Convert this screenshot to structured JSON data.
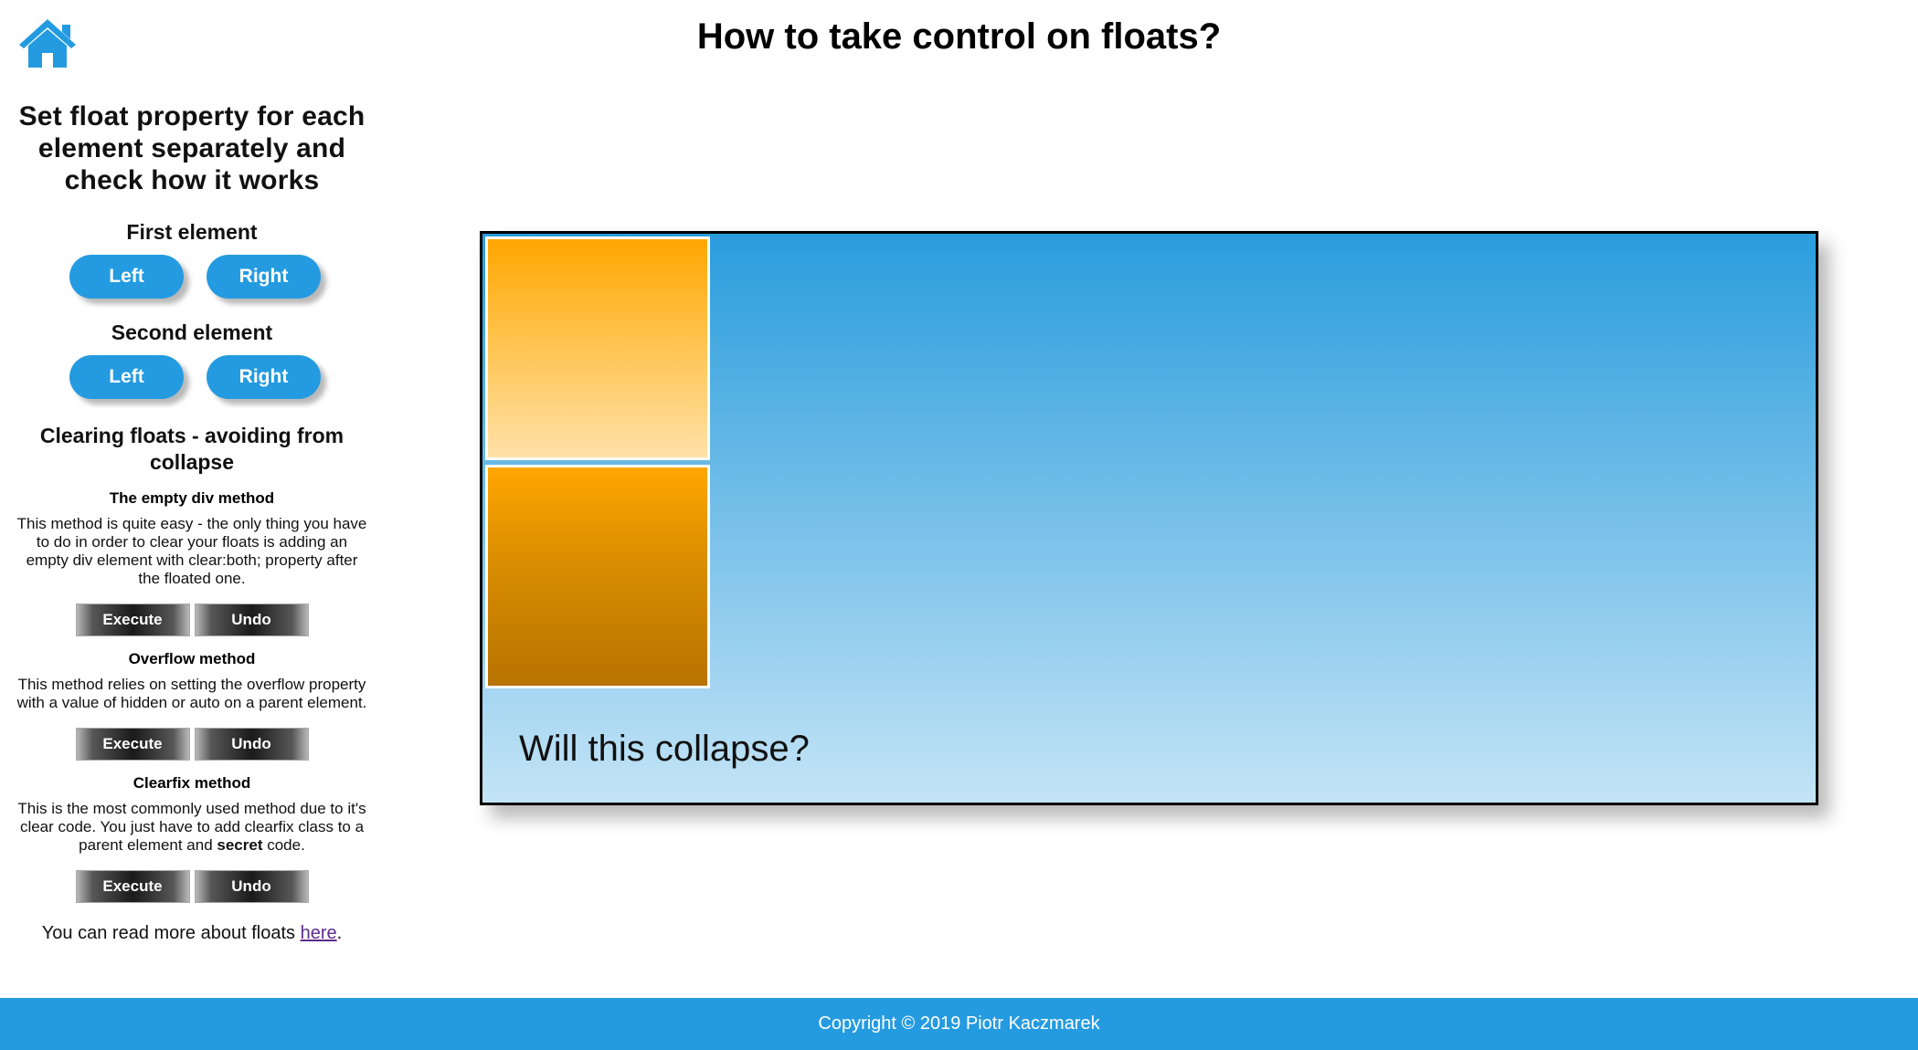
{
  "header": {
    "title": "How to take control on floats?",
    "home_icon": "house-icon"
  },
  "sidebar": {
    "heading": "Set float property for each element separately and check how it works",
    "float_controls": [
      {
        "title": "First element",
        "left_label": "Left",
        "right_label": "Right"
      },
      {
        "title": "Second element",
        "left_label": "Left",
        "right_label": "Right"
      }
    ],
    "clearing_title": "Clearing floats - avoiding from collapse",
    "methods": [
      {
        "title": "The empty div method",
        "description": "This method is quite easy - the only thing you have to do in order to clear your floats is adding an empty div element with clear:both; property after the floated one.",
        "execute_label": "Execute",
        "undo_label": "Undo"
      },
      {
        "title": "Overflow method",
        "description": "This method relies on setting the overflow property with a value of hidden or auto on a parent element.",
        "execute_label": "Execute",
        "undo_label": "Undo"
      },
      {
        "title": "Clearfix method",
        "description_before": "This is the most commonly used method due to it's clear code. You just have to add clearfix class to a parent element and ",
        "description_bold": "secret",
        "description_after": " code.",
        "execute_label": "Execute",
        "undo_label": "Undo"
      }
    ],
    "read_more": {
      "prefix": "You can read more about floats ",
      "link_text": "here",
      "suffix": "."
    }
  },
  "demo": {
    "caption": "Will this collapse?"
  },
  "footer": {
    "copyright": "Copyright © 2019 Piotr Kaczmarek"
  },
  "colors": {
    "accent": "#249be0",
    "orange": "#ffa600",
    "dark_button": "#1a1a1a"
  }
}
